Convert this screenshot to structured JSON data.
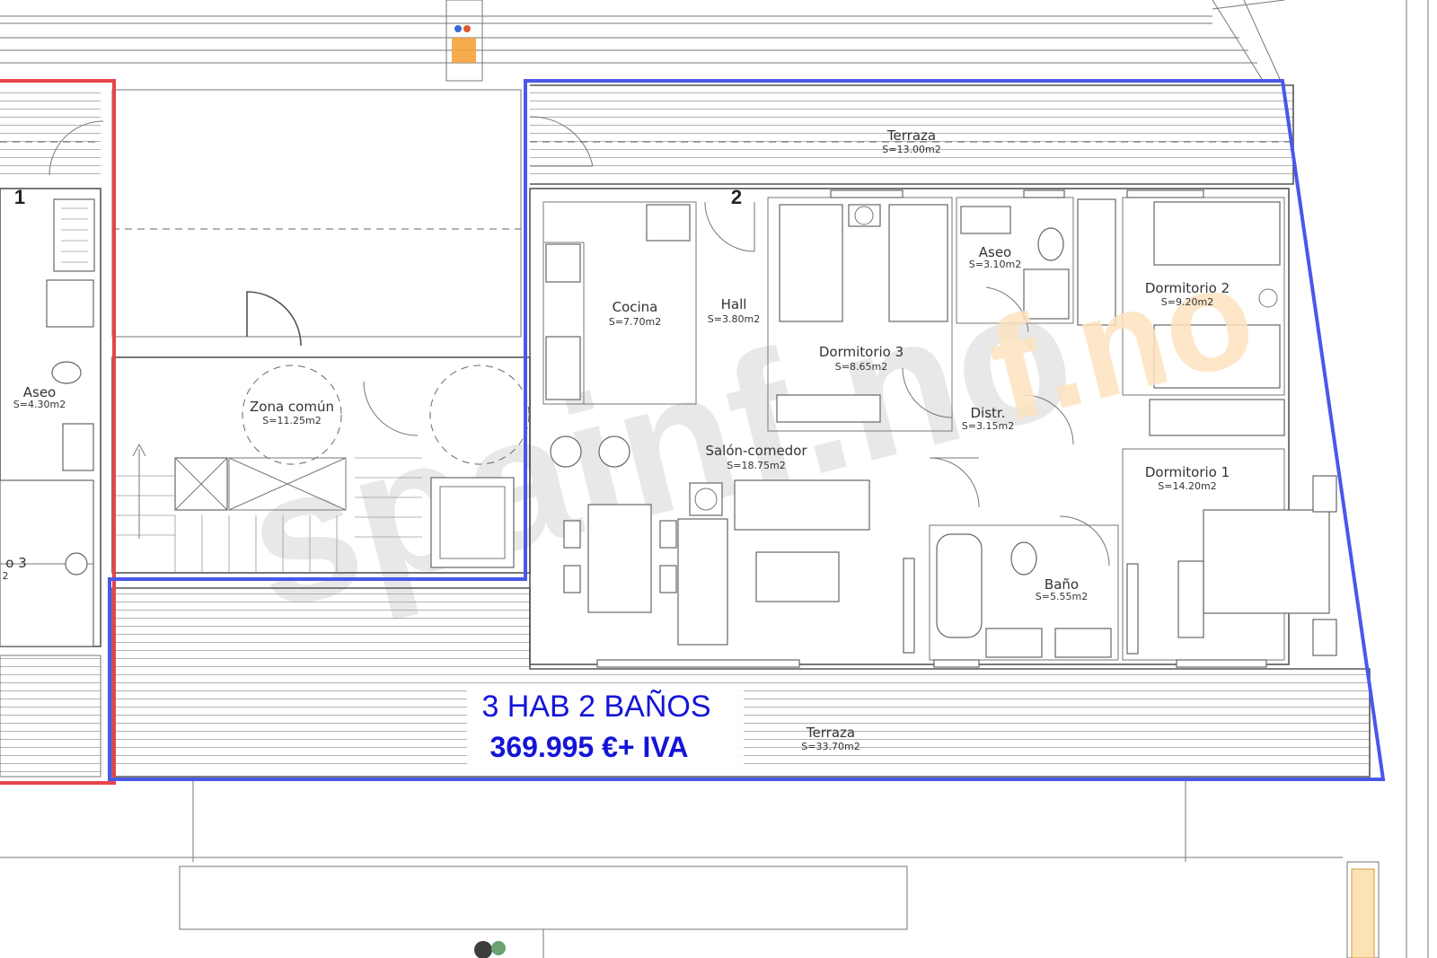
{
  "units": {
    "left": "1",
    "main": "2"
  },
  "rooms": [
    {
      "key": "terraza_top",
      "name": "Terraza",
      "area": "S=13.00m2"
    },
    {
      "key": "cocina",
      "name": "Cocina",
      "area": "S=7.70m2"
    },
    {
      "key": "hall",
      "name": "Hall",
      "area": "S=3.80m2"
    },
    {
      "key": "dormitorio3",
      "name": "Dormitorio 3",
      "area": "S=8.65m2"
    },
    {
      "key": "aseo_main",
      "name": "Aseo",
      "area": "S=3.10m2"
    },
    {
      "key": "dormitorio2",
      "name": "Dormitorio 2",
      "area": "S=9.20m2"
    },
    {
      "key": "distr",
      "name": "Distr.",
      "area": "S=3.15m2"
    },
    {
      "key": "salon",
      "name": "Salón-comedor",
      "area": "S=18.75m2"
    },
    {
      "key": "dormitorio1",
      "name": "Dormitorio 1",
      "area": "S=14.20m2"
    },
    {
      "key": "bano",
      "name": "Baño",
      "area": "S=5.55m2"
    },
    {
      "key": "terraza_bottom",
      "name": "Terraza",
      "area": "S=33.70m2"
    },
    {
      "key": "zona_comun",
      "name": "Zona común",
      "area": "S=11.25m2"
    },
    {
      "key": "aseo_left",
      "name": "Aseo",
      "area": "S=4.30m2"
    },
    {
      "key": "dorm_left",
      "name": "o 3",
      "area": "2"
    }
  ],
  "promo": {
    "line1": "3 HAB 2 BAÑOS",
    "line2": "369.995 €+ IVA"
  },
  "watermark": {
    "text": "spainf.no",
    "colors": {
      "gray": "#d9d9d9",
      "orange": "#fbd7a8"
    }
  },
  "colors": {
    "highlight_main": "#4a58e8",
    "highlight_left": "#e8434a",
    "promo_text": "#1414d8"
  }
}
